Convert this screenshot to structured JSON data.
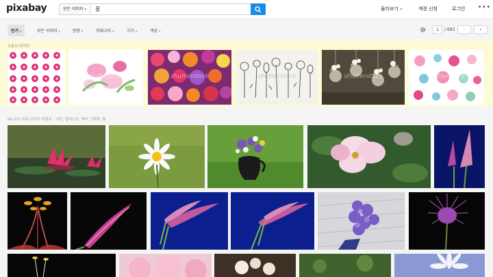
{
  "header": {
    "logo": "pixabay",
    "search_type": "모든 이미지",
    "search_query": "꽃",
    "nav": {
      "explore": "둘러보기",
      "signup": "계정 신청",
      "login": "로그인",
      "more": "•••"
    }
  },
  "filters": {
    "items": [
      {
        "label": "인기",
        "active": true
      },
      {
        "label": "모든 이미지"
      },
      {
        "label": "방향"
      },
      {
        "label": "카테고리"
      },
      {
        "label": "크기"
      },
      {
        "label": "색상"
      }
    ],
    "settings_icon": "gear-icon",
    "pager": {
      "current": "1",
      "total": "/ 683",
      "prev": "‹",
      "next": "›"
    }
  },
  "sponsored": {
    "label": "스폰서 이미지",
    "watermark": "shutterstock"
  },
  "results": {
    "count_text": "68,237 무료 이미지 저장소 - 사진, 일러스트, 벡터 그래픽: 꽃"
  },
  "colors": {
    "accent": "#1b8ce6",
    "sponsored_bg": "#fdfbd6"
  }
}
